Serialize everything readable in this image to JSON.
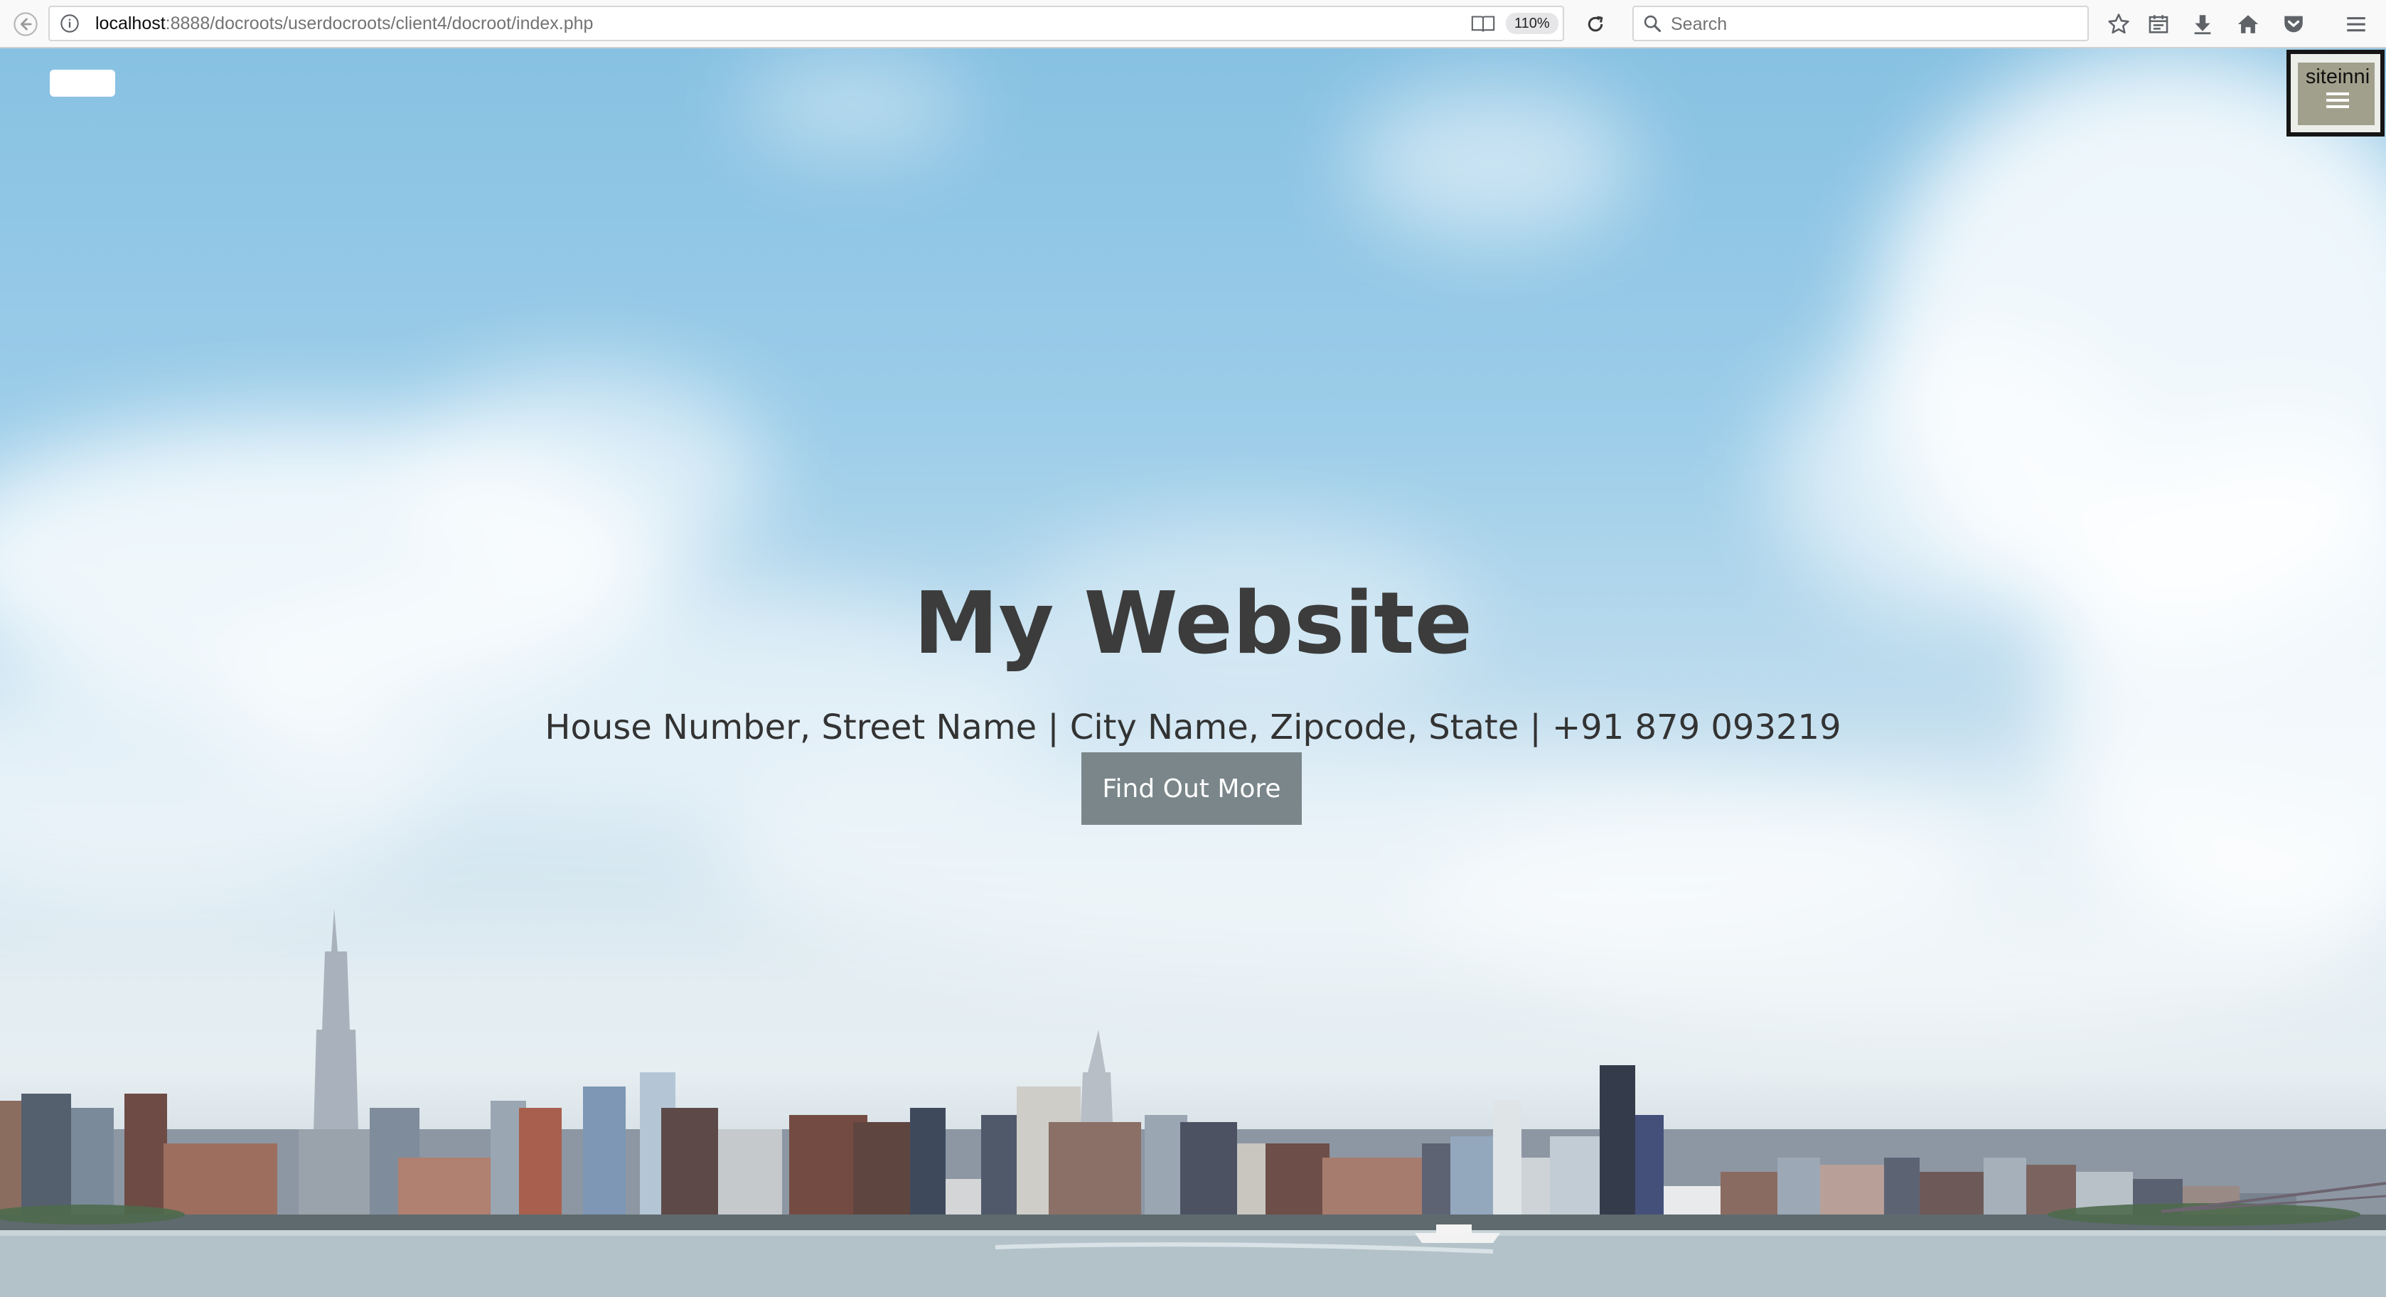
{
  "browser": {
    "url_host": "localhost",
    "url_path": ":8888/docroots/userdocroots/client4/docroot/index.php",
    "zoom": "110%",
    "search_placeholder": "Search"
  },
  "site": {
    "menu_label": "siteinni",
    "title": "My Website",
    "subtitle": "House Number, Street Name | City Name, Zipcode, State | +91 879 093219",
    "cta_label": "Find Out More"
  },
  "icons": {
    "back": "back-arrow-icon",
    "info": "info-icon",
    "reader": "reader-view-icon",
    "reload": "reload-icon",
    "search": "search-icon",
    "bookmark": "star-icon",
    "library": "library-icon",
    "downloads": "download-icon",
    "home": "home-icon",
    "pocket": "pocket-icon",
    "menu": "hamburger-icon"
  },
  "colors": {
    "cta_background": "#7a868a",
    "title_text": "#3c3c3c",
    "menu_toggle": "#a1a08c",
    "sky": "#87c1e2"
  }
}
